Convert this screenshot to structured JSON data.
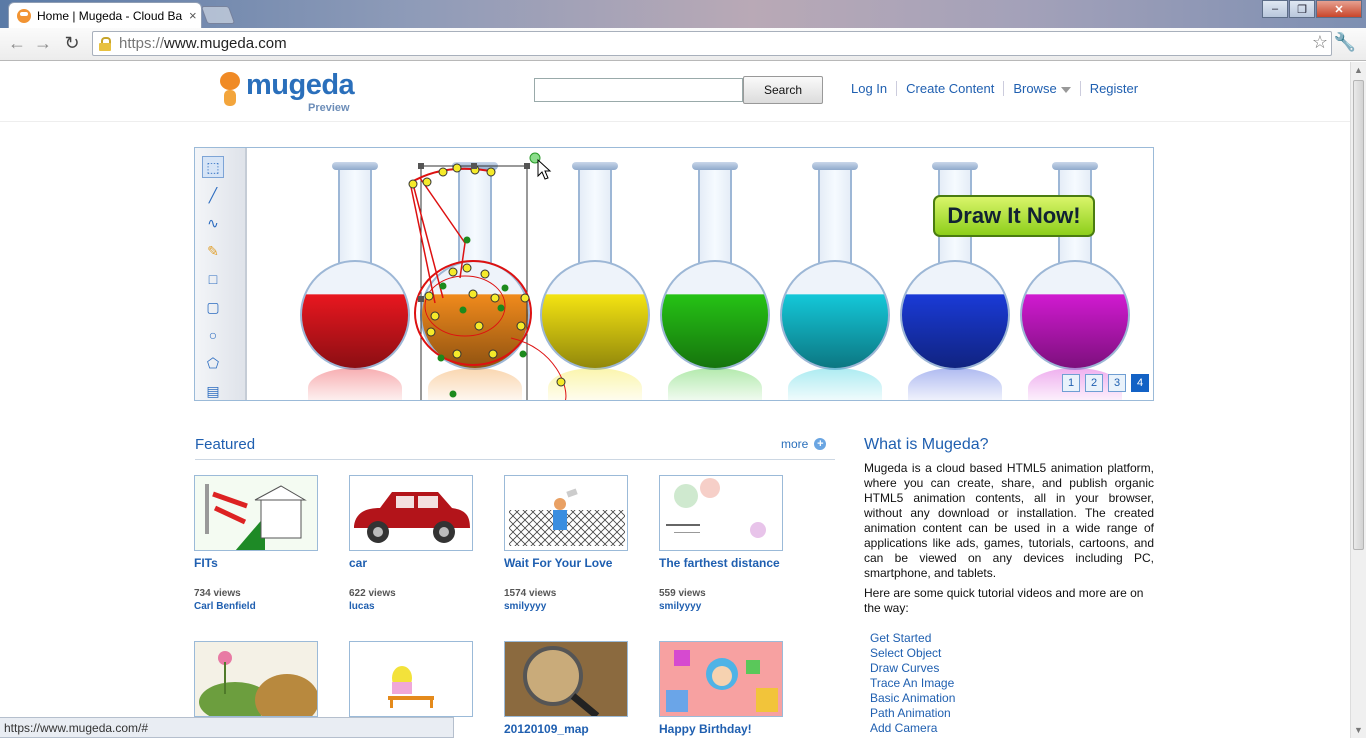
{
  "browser": {
    "tab_title": "Home | Mugeda - Cloud Ba",
    "tab_close": "×",
    "url_protocol": "https://",
    "url_host": "www.mugeda.com",
    "status_url": "https://www.mugeda.com/#"
  },
  "header": {
    "logo_text": "mugeda",
    "logo_sub": "Preview",
    "search_button": "Search",
    "nav": [
      "Log In",
      "Create Content",
      "Browse",
      "Register"
    ]
  },
  "hero": {
    "draw_button": "Draw It Now!",
    "pages": [
      "1",
      "2",
      "3",
      "4"
    ],
    "active_page": "4",
    "flask_colors": [
      "#e8171f",
      "#f08a1c",
      "#f3e312",
      "#25c215",
      "#14c7d8",
      "#1a3ad6",
      "#d01ad0"
    ]
  },
  "featured": {
    "title": "Featured",
    "more": "more",
    "items": [
      {
        "title": "FITs",
        "views": "734 views",
        "author": "Carl Benfield"
      },
      {
        "title": "car",
        "views": "622 views",
        "author": "lucas"
      },
      {
        "title": "Wait For Your Love",
        "views": "1574 views",
        "author": "smilyyyy"
      },
      {
        "title": "The farthest distance",
        "views": "559 views",
        "author": "smilyyyy"
      },
      {
        "title": "",
        "views": "",
        "author": ""
      },
      {
        "title": "",
        "views": "",
        "author": ""
      },
      {
        "title": "20120109_map",
        "views": "",
        "author": ""
      },
      {
        "title": "Happy Birthday!",
        "views": "",
        "author": ""
      }
    ]
  },
  "sidebar": {
    "title": "What is Mugeda?",
    "description": "Mugeda is a cloud based HTML5 animation platform, where you can create, share, and publish organic HTML5 animation contents, all in your browser, without any download or installation. The created animation content can be used in a wide range of applications like ads, games, tutorials, cartoons, and can be viewed on any devices including PC, smartphone, and tablets.",
    "intro": "Here are some quick tutorial videos and more are on the way:",
    "tutorials": [
      "Get Started",
      "Select Object",
      "Draw Curves",
      "Trace An Image",
      "Basic Animation",
      "Path Animation",
      "Add Camera"
    ]
  }
}
